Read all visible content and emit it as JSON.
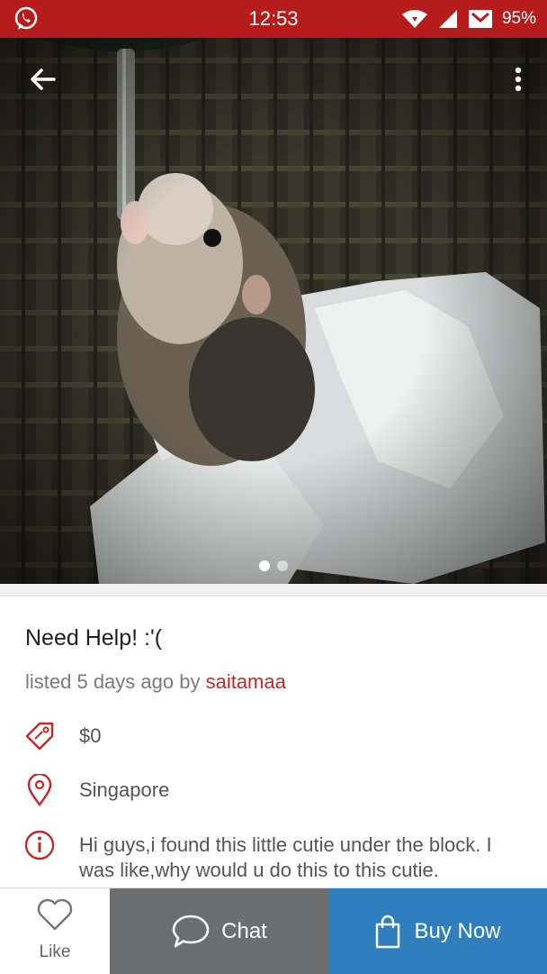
{
  "status_bar": {
    "time": "12:53",
    "battery": "95%"
  },
  "listing": {
    "title": "Need Help! :'(",
    "meta_prefix": "listed 5 days ago by ",
    "seller": "saitamaa",
    "price": "$0",
    "location": "Singapore",
    "description": "Hi guys,i found this little cutie under the block. I was like,why would u do this to this cutie."
  },
  "gallery": {
    "total": 2,
    "active_index": 0
  },
  "actions": {
    "like_label": "Like",
    "chat_label": "Chat",
    "buy_label": "Buy Now"
  },
  "colors": {
    "status_bar": "#b71c1c",
    "accent": "#c62828",
    "chat_bg": "#6d6e70",
    "buy_bg": "#2f7fbf"
  }
}
